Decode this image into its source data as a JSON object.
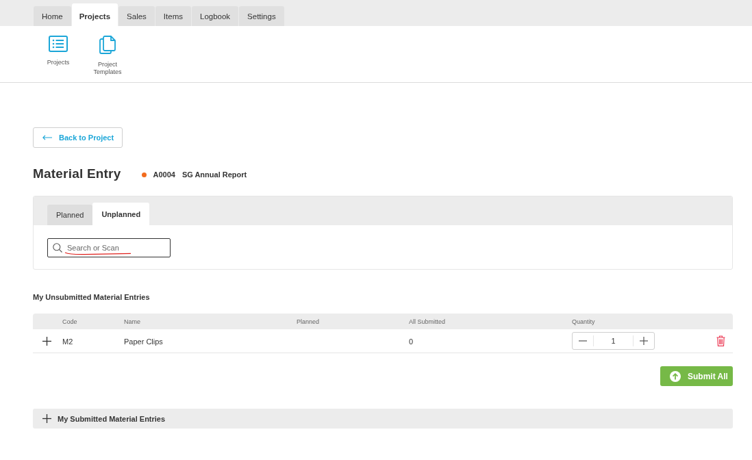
{
  "nav_tabs": [
    {
      "label": "Home",
      "selected": false
    },
    {
      "label": "Projects",
      "selected": true
    },
    {
      "label": "Sales",
      "selected": false
    },
    {
      "label": "Items",
      "selected": false
    },
    {
      "label": "Logbook",
      "selected": false
    },
    {
      "label": "Settings",
      "selected": false
    }
  ],
  "ribbon": [
    {
      "label": "Projects",
      "kind": "list"
    },
    {
      "label": "Project Templates",
      "kind": "pages"
    }
  ],
  "back_button": {
    "label": "Back to Project"
  },
  "page_title": "Material Entry",
  "project": {
    "code": "A0004",
    "name": "SG Annual Report"
  },
  "entry_tabs": [
    {
      "label": "Planned",
      "selected": false
    },
    {
      "label": "Unplanned",
      "selected": true
    }
  ],
  "search": {
    "placeholder": "Search or Scan"
  },
  "unsubmitted": {
    "title": "My Unsubmitted Material Entries",
    "columns": [
      "Code",
      "Name",
      "Planned",
      "All Submitted",
      "Quantity"
    ],
    "rows": [
      {
        "expanded": false,
        "code": "M2",
        "name": "Paper Clips",
        "all_submitted": "0",
        "quantity": "1"
      }
    ]
  },
  "submit_button": {
    "label": "Submit All"
  },
  "submitted": {
    "title": "My Submitted Material Entries",
    "expanded": false
  }
}
